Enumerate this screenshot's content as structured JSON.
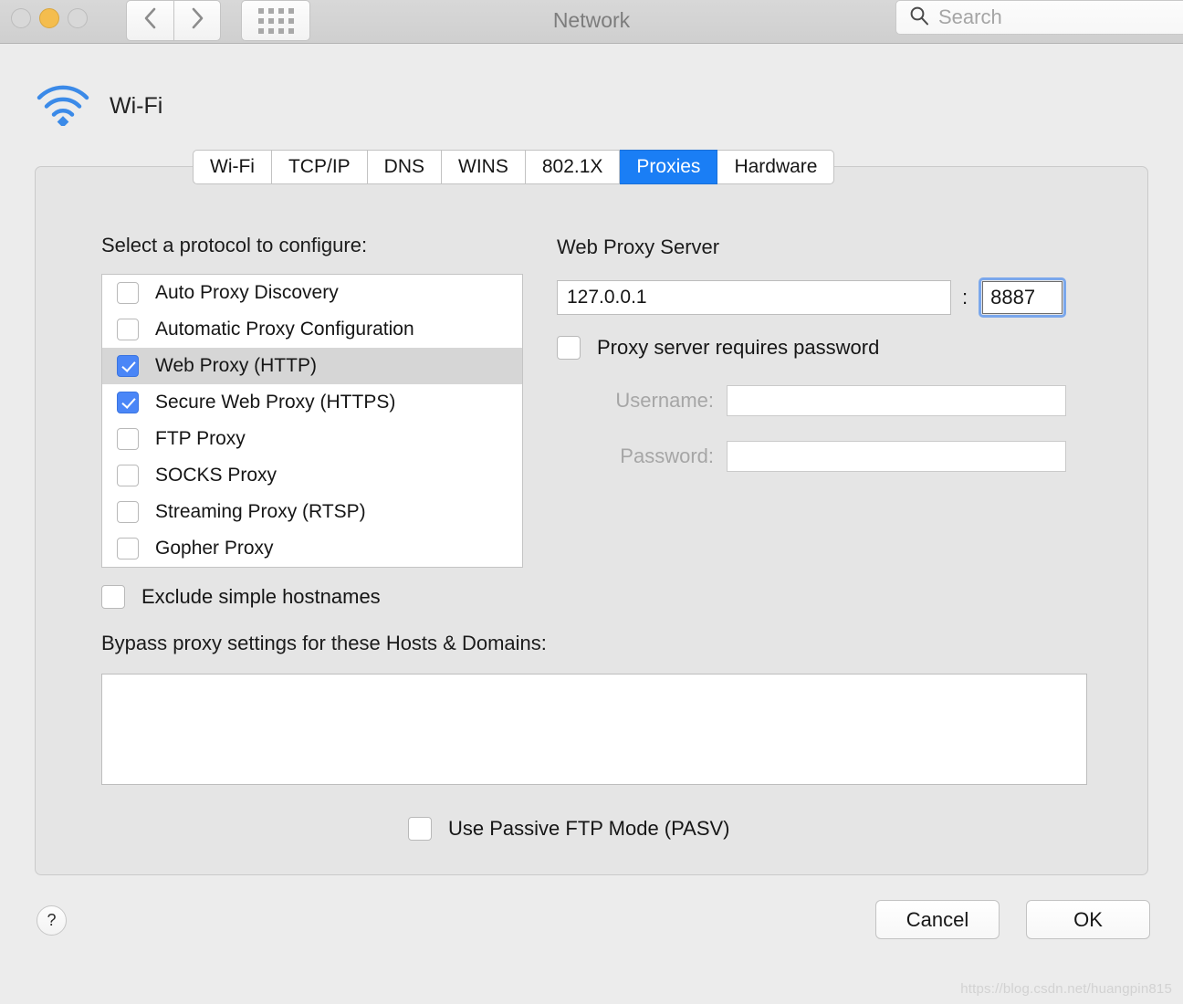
{
  "window": {
    "title": "Network",
    "traffic_lights": [
      "close",
      "minimize",
      "zoom"
    ]
  },
  "toolbar": {
    "back_icon": "chevron-left-icon",
    "forward_icon": "chevron-right-icon",
    "apps_icon": "grid-apps-icon",
    "search": {
      "icon": "search-icon",
      "placeholder": "Search",
      "value": ""
    }
  },
  "service": {
    "icon": "wifi-icon",
    "name": "Wi-Fi"
  },
  "tabs": [
    {
      "label": "Wi-Fi",
      "selected": false
    },
    {
      "label": "TCP/IP",
      "selected": false
    },
    {
      "label": "DNS",
      "selected": false
    },
    {
      "label": "WINS",
      "selected": false
    },
    {
      "label": "802.1X",
      "selected": false
    },
    {
      "label": "Proxies",
      "selected": true
    },
    {
      "label": "Hardware",
      "selected": false
    }
  ],
  "proxies": {
    "protocol_label": "Select a protocol to configure:",
    "protocols": [
      {
        "label": "Auto Proxy Discovery",
        "checked": false,
        "selected": false
      },
      {
        "label": "Automatic Proxy Configuration",
        "checked": false,
        "selected": false
      },
      {
        "label": "Web Proxy (HTTP)",
        "checked": true,
        "selected": true
      },
      {
        "label": "Secure Web Proxy (HTTPS)",
        "checked": true,
        "selected": false
      },
      {
        "label": "FTP Proxy",
        "checked": false,
        "selected": false
      },
      {
        "label": "SOCKS Proxy",
        "checked": false,
        "selected": false
      },
      {
        "label": "Streaming Proxy (RTSP)",
        "checked": false,
        "selected": false
      },
      {
        "label": "Gopher Proxy",
        "checked": false,
        "selected": false
      }
    ],
    "server_section_title": "Web Proxy Server",
    "server_host": "127.0.0.1",
    "server_host_placeholder": "",
    "port_separator": ":",
    "server_port": "8887",
    "requires_password_label": "Proxy server requires password",
    "requires_password_checked": false,
    "username_label": "Username:",
    "username_value": "",
    "password_label": "Password:",
    "password_value": "",
    "exclude_simple_hostnames_label": "Exclude simple hostnames",
    "exclude_simple_hostnames_checked": false,
    "bypass_label": "Bypass proxy settings for these Hosts & Domains:",
    "bypass_value": "",
    "passive_ftp_label": "Use Passive FTP Mode (PASV)",
    "passive_ftp_checked": false
  },
  "footer": {
    "help_label": "?",
    "cancel_label": "Cancel",
    "ok_label": "OK"
  },
  "watermark": "https://blog.csdn.net/huangpin815",
  "colors": {
    "accent_blue": "#1a7ef5",
    "checkbox_blue": "#4a86f7",
    "focus_ring": "#7aa7ec",
    "window_bg": "#ececec",
    "panel_bg": "#e5e5e5",
    "minimize_yellow": "#f4bd4e"
  }
}
